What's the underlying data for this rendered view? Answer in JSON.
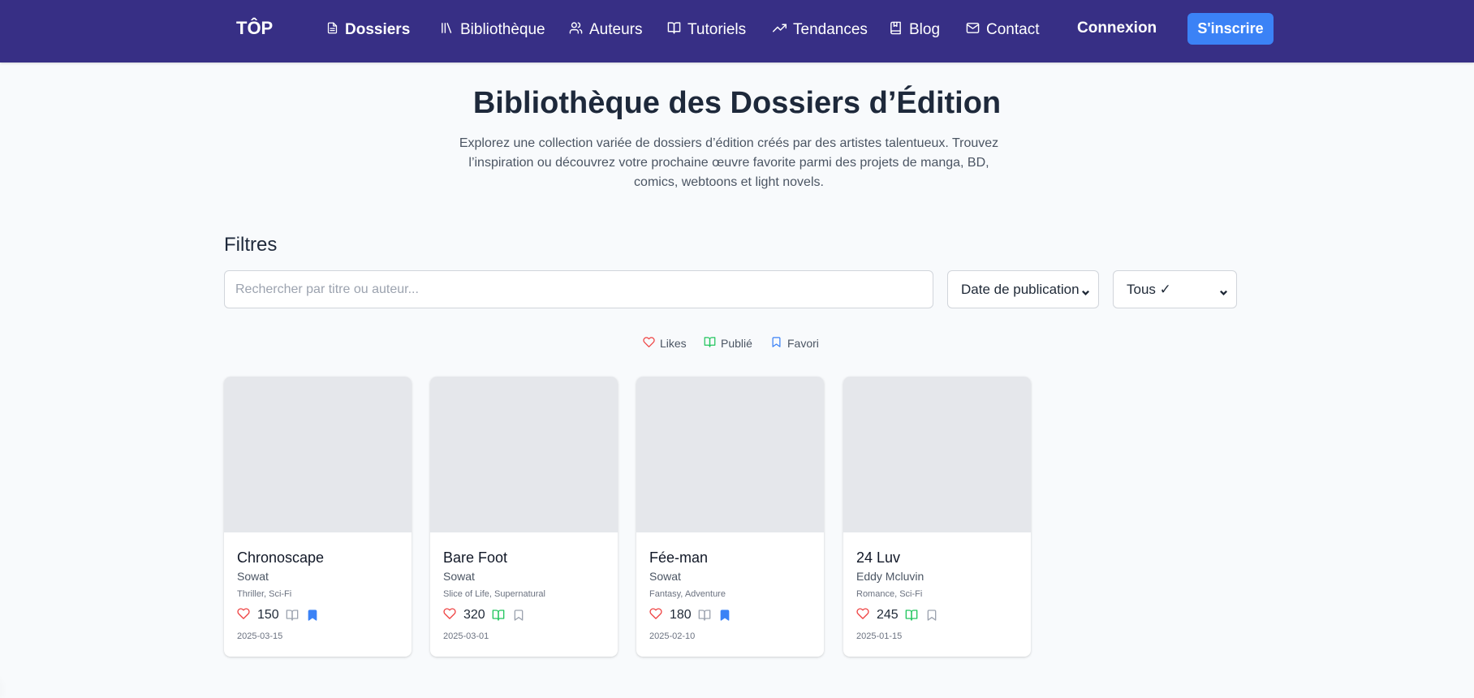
{
  "colors": {
    "navbar": "#372f85",
    "accent": "#3b82f6",
    "like": "#ef4444",
    "published": "#22c55e",
    "favorite": "#3b82f6",
    "inactive_icon": "#9ca3af",
    "cover_placeholder": "#e5e7eb"
  },
  "nav": {
    "brand": "TÔP",
    "items": [
      {
        "label": "Dossiers",
        "icon": "file-text-icon",
        "active": true
      },
      {
        "label": "Bibliothèque",
        "icon": "library-icon"
      },
      {
        "label": "Auteurs",
        "icon": "users-icon"
      },
      {
        "label": "Tutoriels",
        "icon": "book-open-icon"
      },
      {
        "label": "Tendances",
        "icon": "trending-up-icon"
      },
      {
        "label": "Blog",
        "icon": "book-bookmark-icon"
      },
      {
        "label": "Contact",
        "icon": "mail-icon"
      }
    ],
    "login": "Connexion",
    "signup": "S'inscrire"
  },
  "header": {
    "title": "Bibliothèque des Dossiers d’Édition",
    "description": "Explorez une collection variée de dossiers d’édition créés par des artistes talentueux. Trouvez l’inspiration ou découvrez votre prochaine œuvre favorite parmi des projets de manga, BD, comics, webtoons et light novels."
  },
  "filters": {
    "title": "Filtres",
    "search_placeholder": "Rechercher par titre ou auteur...",
    "search_value": "",
    "sort_selected": "Date de publication",
    "status_selected": "Tous ✓"
  },
  "legend": {
    "likes": "Likes",
    "published": "Publié",
    "favorite": "Favori"
  },
  "cards": [
    {
      "title": "Chronoscape",
      "author": "Sowat",
      "genres": "Thriller, Sci-Fi",
      "likes": "150",
      "published": false,
      "favorite": true,
      "date": "2025-03-15"
    },
    {
      "title": "Bare Foot",
      "author": "Sowat",
      "genres": "Slice of Life, Supernatural",
      "likes": "320",
      "published": true,
      "favorite": false,
      "date": "2025-03-01"
    },
    {
      "title": "Fée-man",
      "author": "Sowat",
      "genres": "Fantasy, Adventure",
      "likes": "180",
      "published": false,
      "favorite": true,
      "date": "2025-02-10"
    },
    {
      "title": "24 Luv",
      "author": "Eddy Mcluvin",
      "genres": "Romance, Sci-Fi",
      "likes": "245",
      "published": true,
      "favorite": false,
      "date": "2025-01-15"
    }
  ]
}
